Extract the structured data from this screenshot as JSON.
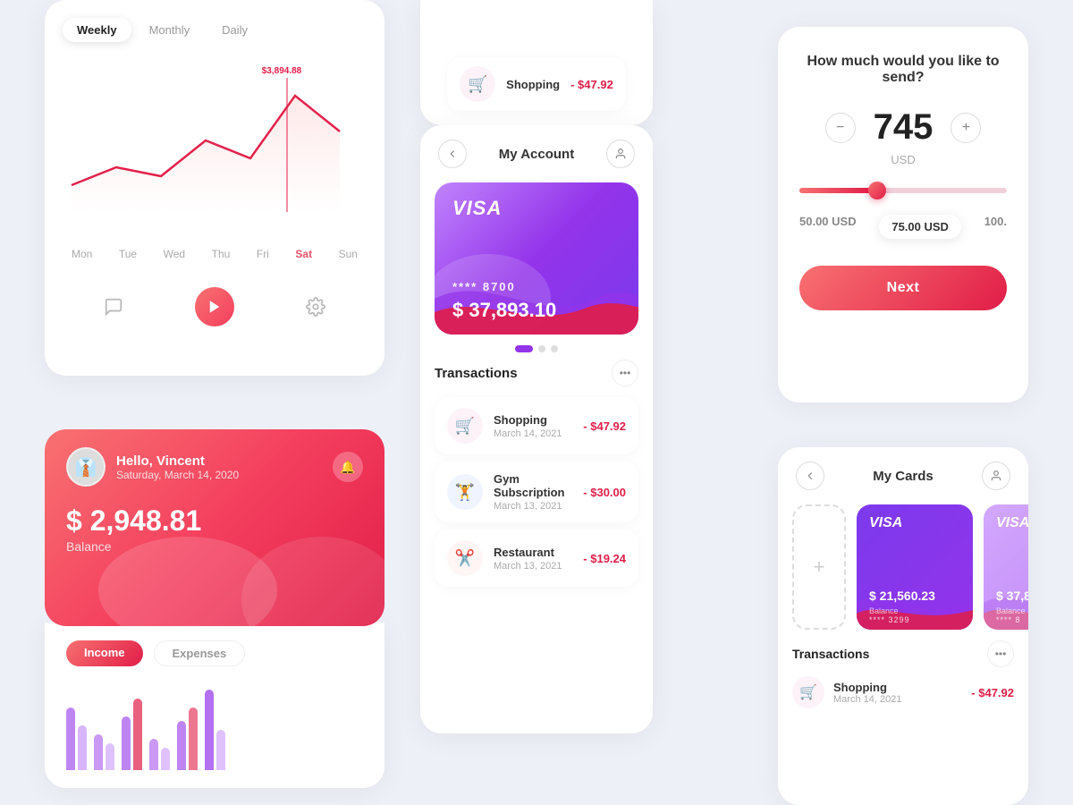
{
  "colors": {
    "primary": "#e11d48",
    "primary_light": "#f87171",
    "purple": "#7c3aed",
    "purple_light": "#c084fc",
    "bg": "#eef0f7"
  },
  "chart_card": {
    "tabs": [
      "Weekly",
      "Monthly",
      "Daily"
    ],
    "active_tab": "Weekly",
    "chart_value": "$3,894.88",
    "days": [
      "Mon",
      "Tue",
      "Wed",
      "Thu",
      "Fri",
      "Sat",
      "Sun"
    ],
    "active_day": "Sat",
    "actions": {
      "chat_icon": "💬",
      "play_icon": "▶",
      "settings_icon": "⚙"
    }
  },
  "hello_card": {
    "greeting": "Hello, Vincent",
    "date": "Saturday, March 14, 2020",
    "balance": "$ 2,948.81",
    "balance_label": "Balance",
    "tabs": [
      "Income",
      "Expenses"
    ],
    "active_tab": "Income"
  },
  "account_card": {
    "title": "My Account",
    "visa_number": "**** 8700",
    "visa_balance": "$ 37,893.10",
    "transactions_title": "Transactions",
    "transactions": [
      {
        "name": "Shopping",
        "date": "March 14, 2021",
        "amount": "- $47.92",
        "icon": "🛒",
        "icon_type": "shopping"
      },
      {
        "name": "Gym Subscription",
        "date": "March 13, 2021",
        "amount": "- $30.00",
        "icon": "🏋",
        "icon_type": "gym"
      },
      {
        "name": "Restaurant",
        "date": "March 13, 2021",
        "amount": "- $19.24",
        "icon": "✂",
        "icon_type": "restaurant"
      }
    ]
  },
  "top_partial": {
    "icon": "🛒",
    "name": "Shopping",
    "amount": "- $47.92"
  },
  "send_card": {
    "title": "How much would you like to send?",
    "amount": "745",
    "currency": "USD",
    "slider_percent": 35,
    "presets": [
      {
        "label": "50.00 USD",
        "highlighted": false
      },
      {
        "label": "75.00 USD",
        "highlighted": true
      },
      {
        "label": "100.",
        "highlighted": false
      }
    ],
    "next_label": "Next"
  },
  "cards_card": {
    "title": "My Cards",
    "cards": [
      {
        "type": "VISA",
        "balance": "$ 21,560.23",
        "balance_label": "Balance",
        "number": "**** 3299",
        "style": "purple"
      },
      {
        "type": "VISA",
        "balance": "$ 37,8",
        "balance_label": "Balance",
        "number": "**** 8",
        "style": "pink"
      }
    ],
    "transactions_title": "Transactions",
    "transactions": [
      {
        "name": "Shopping",
        "date": "March 14, 2021",
        "amount": "- $47.92",
        "icon": "🛒"
      }
    ]
  }
}
